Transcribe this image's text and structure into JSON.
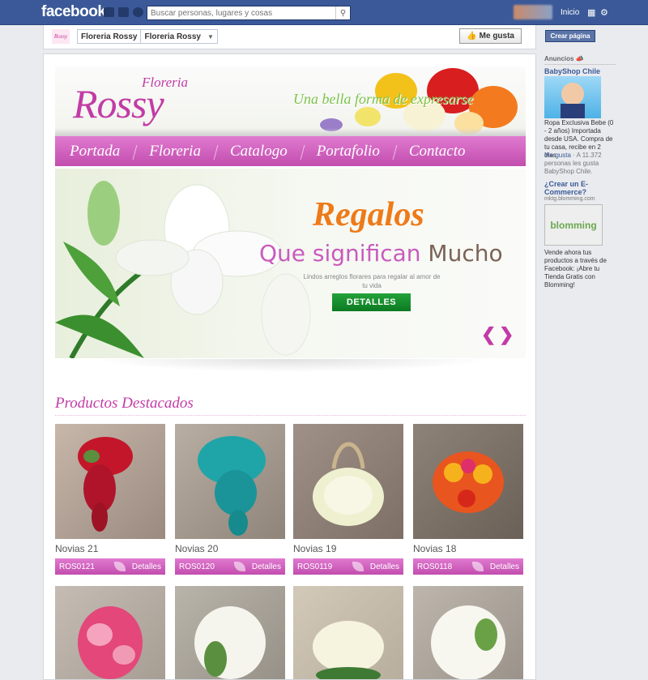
{
  "facebook": {
    "logo": "facebook",
    "search_placeholder": "Buscar personas, lugares y cosas",
    "home": "Inicio",
    "jewels": [
      "friend-requests-icon",
      "messages-icon",
      "notifications-icon"
    ]
  },
  "page_header": {
    "thumb_text": "Rossy",
    "page_name": "Floreria Rossy",
    "tab_name": "Floreria Rossy",
    "like_button": "Me gusta"
  },
  "banner": {
    "brand_small": "Floreria",
    "brand_big": "Rossy",
    "tagline": "Una bella forma de expresarse"
  },
  "nav": [
    "Portada",
    "Floreria",
    "Catalogo",
    "Portafolio",
    "Contacto"
  ],
  "slider": {
    "title": "Regalos",
    "subtitle_part1": "Que significan",
    "subtitle_part2": "Mucho",
    "description": "Lindos arreglos florares para regalar al amor de tu vida",
    "button": "DETALLES"
  },
  "products_section": {
    "title": "Productos Destacados",
    "products": [
      {
        "name": "Novias 21",
        "code": "ROS0121",
        "link": "Detalles"
      },
      {
        "name": "Novias 20",
        "code": "ROS0120",
        "link": "Detalles"
      },
      {
        "name": "Novias 19",
        "code": "ROS0119",
        "link": "Detalles"
      },
      {
        "name": "Novias 18",
        "code": "ROS0118",
        "link": "Detalles"
      }
    ]
  },
  "sidebar": {
    "create_page": "Crear página",
    "ads_heading": "Anuncios",
    "ad1": {
      "title": "BabyShop Chile",
      "text": "Ropa Exclusiva Bebe (0 - 2 años) Importada desde USA. Compra de tu casa, recibe en 2 dias",
      "like_link": "Me gusta",
      "like_text": " · A 11.372 personas les gusta BabyShop Chile."
    },
    "ad2": {
      "title": "¿Crear un E-Commerce?",
      "url": "mktg.blomming.com",
      "image_text": "blomming",
      "text": "Vende ahora tus productos a través de Facebook: ¡Abre tu Tienda Gratis con Blomming!"
    }
  },
  "colors": {
    "facebook_blue": "#3b5998",
    "brand_pink": "#c23ba6",
    "orange": "#ee7a18",
    "green_button": "#0c7a22"
  }
}
